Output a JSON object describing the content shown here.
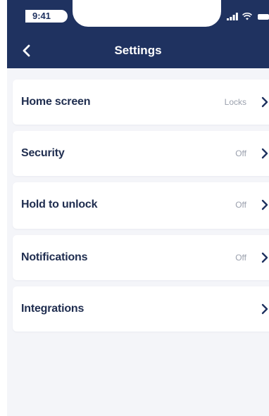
{
  "status_bar": {
    "time": "9:41",
    "icons": [
      "signal-icon",
      "wifi-icon",
      "battery-icon"
    ]
  },
  "nav_bar": {
    "title": "Settings",
    "back_icon": "chevron-left-icon"
  },
  "settings": {
    "items": [
      {
        "label": "Home screen",
        "value": "Locks"
      },
      {
        "label": "Security",
        "value": "Off"
      },
      {
        "label": "Hold to unlock",
        "value": "Off"
      },
      {
        "label": "Notifications",
        "value": "Off"
      },
      {
        "label": "Integrations",
        "value": ""
      }
    ]
  },
  "colors": {
    "header_bg": "#1f3260",
    "page_bg": "#f4f5f9",
    "row_bg": "#ffffff",
    "label_text": "#1f2d4f",
    "value_text": "#9aa0ad",
    "chevron": "#1f3260"
  }
}
